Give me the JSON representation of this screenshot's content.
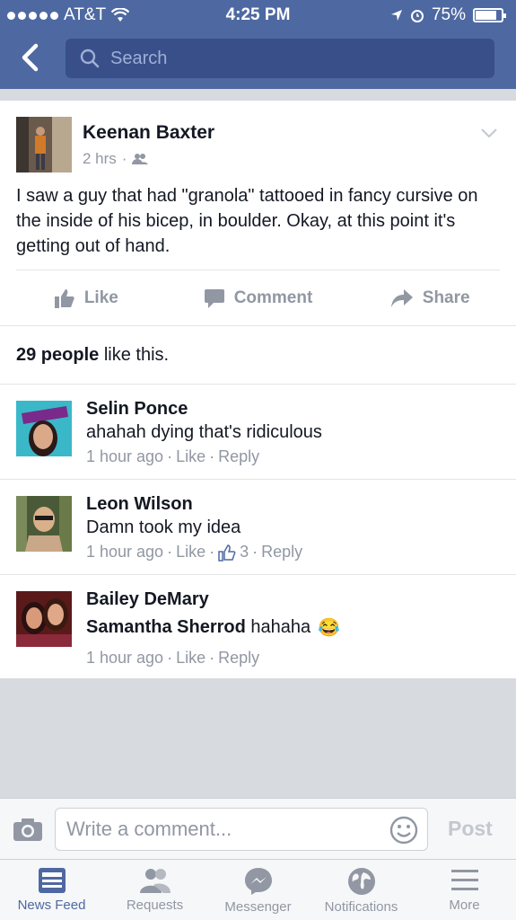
{
  "status_bar": {
    "carrier": "AT&T",
    "time": "4:25 PM",
    "battery": "75%",
    "icons": [
      "signal-dots-icon",
      "wifi-icon",
      "location-arrow-icon",
      "alarm-icon",
      "battery-icon"
    ]
  },
  "header": {
    "back_icon": "chevron-left-icon",
    "search_placeholder": "Search"
  },
  "post": {
    "author": "Keenan Baxter",
    "time": "2 hrs",
    "audience_icon": "friends-icon",
    "text": "I saw a guy that had \"granola\" tattooed in fancy cursive on the inside of his bicep, in boulder. Okay, at this point it's getting out of hand.",
    "actions": {
      "like": "Like",
      "comment": "Comment",
      "share": "Share"
    },
    "likes_count": "29 people",
    "likes_suffix": " like this."
  },
  "comments": [
    {
      "name": "Selin Ponce",
      "text": "ahahah dying that's ridiculous",
      "time": "1 hour ago",
      "like": "Like",
      "reply": "Reply"
    },
    {
      "name": "Leon Wilson",
      "text": "Damn took my idea",
      "time": "1 hour ago",
      "like": "Like",
      "like_count": "3",
      "reply": "Reply"
    },
    {
      "name": "Bailey DeMary",
      "mention": "Samantha Sherrod",
      "text": " hahaha",
      "emoji": "😂",
      "time": "1 hour ago",
      "like": "Like",
      "reply": "Reply"
    }
  ],
  "composer": {
    "placeholder": "Write a comment...",
    "post_label": "Post"
  },
  "tabs": [
    {
      "label": "News Feed",
      "icon": "news-feed-icon",
      "active": true
    },
    {
      "label": "Requests",
      "icon": "requests-icon",
      "active": false
    },
    {
      "label": "Messenger",
      "icon": "messenger-icon",
      "active": false
    },
    {
      "label": "Notifications",
      "icon": "globe-icon",
      "active": false
    },
    {
      "label": "More",
      "icon": "menu-icon",
      "active": false
    }
  ],
  "colors": {
    "brand": "#4e69a2",
    "muted": "#9197a3",
    "text": "#141823"
  }
}
